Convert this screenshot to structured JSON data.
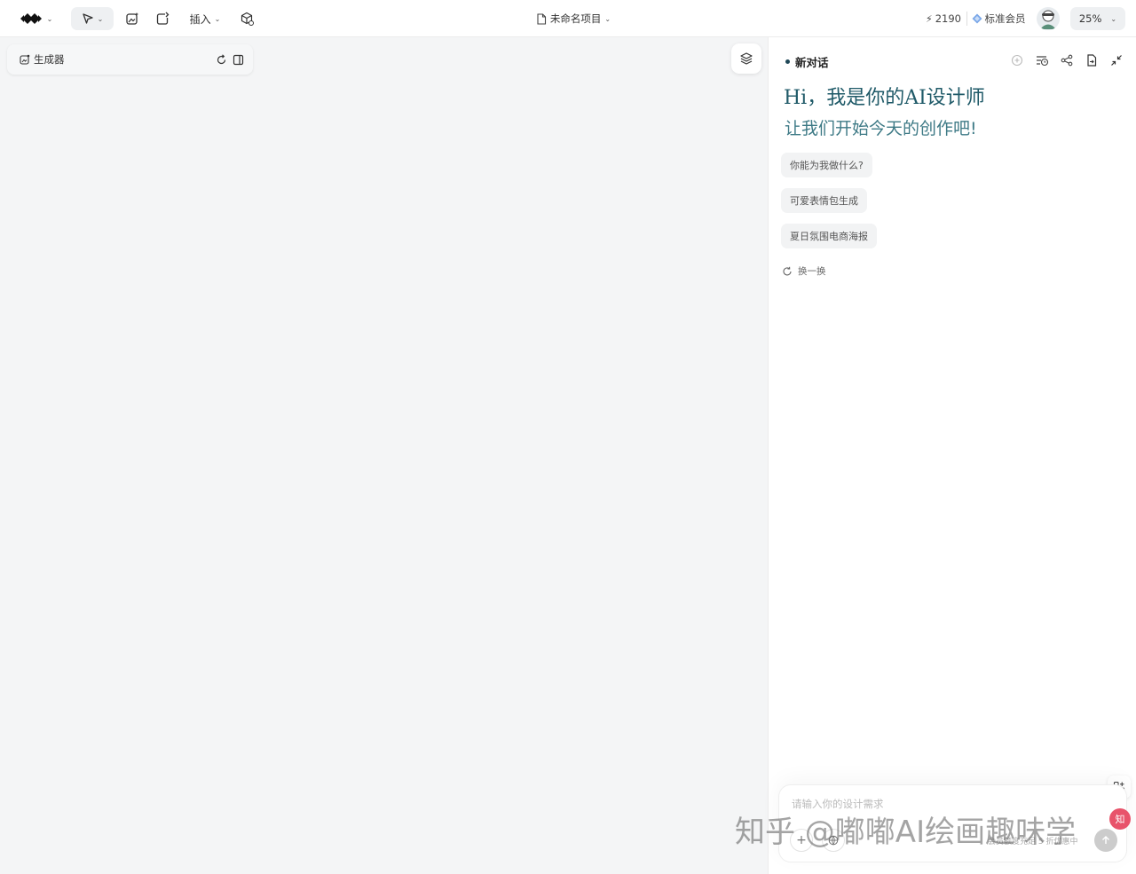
{
  "topbar": {
    "insert_label": "插入",
    "project_name": "未命名项目",
    "credits": "2190",
    "membership": "标准会员",
    "zoom": "25%"
  },
  "canvas": {
    "generator_label": "生成器"
  },
  "chat": {
    "title": "新对话",
    "greeting_line1": "Hi，我是你的AI设计师",
    "greeting_line2": "让我们开始今天的创作吧!",
    "suggestions": [
      "你能为我做什么?",
      "可爱表情包生成",
      "夏日氛围电商海报"
    ],
    "refresh_label": "换一换",
    "input_placeholder": "请输入你的设计需求",
    "input_hint": "会员额度充足 5 折优惠中"
  },
  "watermark": "知乎 @嘟嘟AI绘画趣味学",
  "colors": {
    "accent": "#1f5a68",
    "accent_light": "#3e7a86",
    "canvas_bg": "#f4f5f6"
  }
}
